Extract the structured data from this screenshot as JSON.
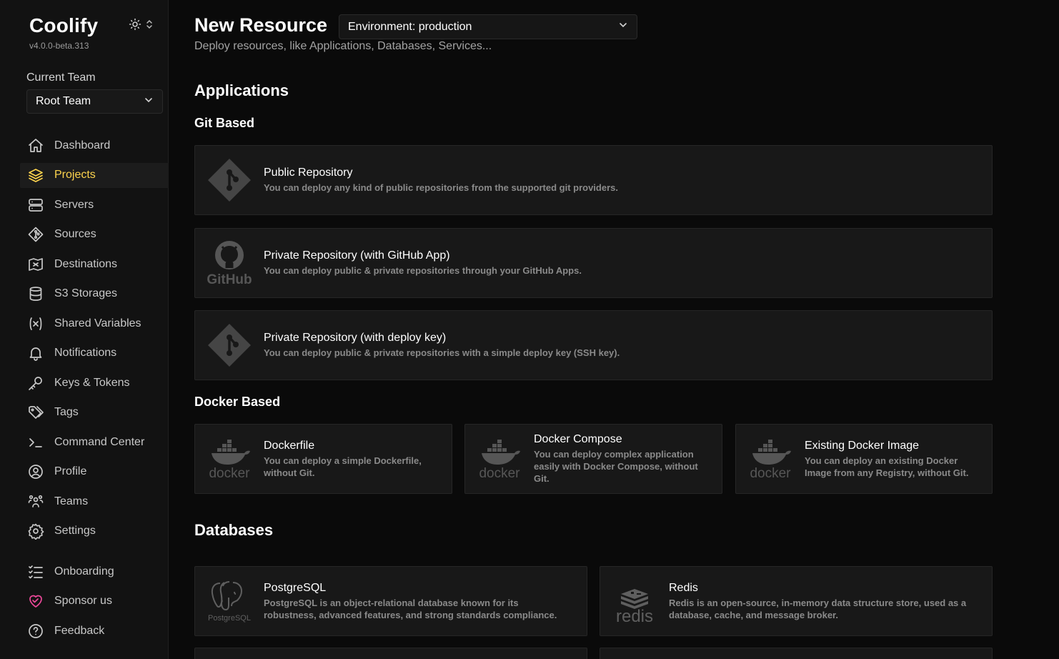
{
  "sidebar": {
    "brand": "Coolify",
    "version": "v4.0.0-beta.313",
    "team_label": "Current Team",
    "team_value": "Root Team",
    "items": [
      {
        "label": "Dashboard",
        "icon": "home-icon"
      },
      {
        "label": "Projects",
        "icon": "layers-icon",
        "active": true
      },
      {
        "label": "Servers",
        "icon": "server-icon"
      },
      {
        "label": "Sources",
        "icon": "git-icon"
      },
      {
        "label": "Destinations",
        "icon": "destinations-icon"
      },
      {
        "label": "S3 Storages",
        "icon": "database-icon"
      },
      {
        "label": "Shared Variables",
        "icon": "variable-icon"
      },
      {
        "label": "Notifications",
        "icon": "bell-icon"
      },
      {
        "label": "Keys & Tokens",
        "icon": "key-icon"
      },
      {
        "label": "Tags",
        "icon": "tag-icon"
      },
      {
        "label": "Command Center",
        "icon": "terminal-icon"
      },
      {
        "label": "Profile",
        "icon": "user-circle-icon"
      },
      {
        "label": "Teams",
        "icon": "users-icon"
      },
      {
        "label": "Settings",
        "icon": "gear-icon"
      }
    ],
    "bottom_items": [
      {
        "label": "Onboarding",
        "icon": "checklist-icon"
      },
      {
        "label": "Sponsor us",
        "icon": "heart-icon"
      },
      {
        "label": "Feedback",
        "icon": "help-icon"
      }
    ]
  },
  "header": {
    "title": "New Resource",
    "environment": "Environment: production",
    "subtitle": "Deploy resources, like Applications, Databases, Services..."
  },
  "sections": {
    "applications": "Applications",
    "git_based": "Git Based",
    "docker_based": "Docker Based",
    "databases": "Databases"
  },
  "git_cards": [
    {
      "title": "Public Repository",
      "desc": "You can deploy any kind of public repositories from the supported git providers.",
      "logo": "git-logo-icon"
    },
    {
      "title": "Private Repository (with GitHub App)",
      "desc": "You can deploy public & private repositories through your GitHub Apps.",
      "logo": "github-logo-icon"
    },
    {
      "title": "Private Repository (with deploy key)",
      "desc": "You can deploy public & private repositories with a simple deploy key (SSH key).",
      "logo": "git-logo-icon"
    }
  ],
  "docker_cards": [
    {
      "title": "Dockerfile",
      "desc": "You can deploy a simple Dockerfile, without Git.",
      "logo": "docker-logo-icon"
    },
    {
      "title": "Docker Compose",
      "desc": "You can deploy complex application easily with Docker Compose, without Git.",
      "logo": "docker-logo-icon"
    },
    {
      "title": "Existing Docker Image",
      "desc": "You can deploy an existing Docker Image from any Registry, without Git.",
      "logo": "docker-logo-icon"
    }
  ],
  "db_cards": [
    {
      "title": "PostgreSQL",
      "desc": "PostgreSQL is an object-relational database known for its robustness, advanced features, and strong standards compliance.",
      "logo": "postgresql-logo-icon",
      "logo_text": "PostgreSQL"
    },
    {
      "title": "Redis",
      "desc": "Redis is an open-source, in-memory data structure store, used as a database, cache, and message broker.",
      "logo": "redis-logo-icon",
      "logo_text": "redis"
    }
  ],
  "logo_text": {
    "github": "GitHub",
    "docker": "docker"
  },
  "colors": {
    "accent": "#fcd34d",
    "background": "#0a0a0a",
    "card": "#181818"
  }
}
